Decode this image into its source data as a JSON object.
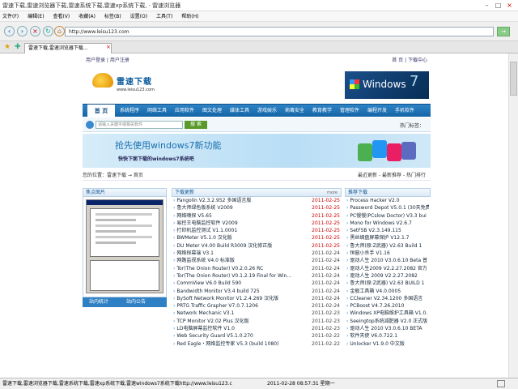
{
  "window": {
    "title": "雷速下载,雷速浏览器下载,雷速系统下载,雷速xp系统下载, · 雷速浏览器"
  },
  "menu": [
    "文件(F)",
    "编辑(E)",
    "查看(V)",
    "收藏(A)",
    "标签(B)",
    "设置(O)",
    "工具(T)",
    "帮助(H)"
  ],
  "address": {
    "url": "http://www.leisu123.com"
  },
  "tab": {
    "label": "雷速下载,雷速浏览器下载..."
  },
  "status": {
    "text": "雷速下载,雷速浏览器下载,雷速系统下载,雷速xp系统下载,雷速windows7系统下载http://www.leisu123.c",
    "datetime": "2011-02-28 08:57:31 星期一"
  },
  "page": {
    "top_left": "用户登录 | 用户注册",
    "top_right": "首 页 | 下载中心",
    "logo": {
      "name": "雷速下载",
      "url": "www.leisu123.com"
    },
    "win7": {
      "word": "Windows",
      "num": "7"
    },
    "nav": [
      "首 页",
      "系统程序",
      "网络工具",
      "应用软件",
      "图文处理",
      "媒体工具",
      "游戏娱乐",
      "病毒安全",
      "教育教学",
      "管理软件",
      "编程开发",
      "手机软件"
    ],
    "search": {
      "placeholder": "请输入关键字或相关软件",
      "button": "搜 索",
      "hot": "热门标签："
    },
    "banner": {
      "line1": "抢先使用windows7新功能",
      "line2": "快快下面下载的windows7系统吧"
    },
    "crumb": "您的位置：雷速下载 → 首页",
    "crumb_right": "最近更新 - 最新推荐 - 热门排行",
    "col1": {
      "title": "焦点图片",
      "tabs": [
        "站内统计",
        "站内公告"
      ]
    },
    "col2": {
      "title": "下载更新",
      "more": "more",
      "items": [
        {
          "name": "Pangolin V2.3.2.952 多国语言版",
          "date": "2011-02-25",
          "red": true
        },
        {
          "name": "鲁大师绿色版系统 V2009",
          "date": "2011-02-25",
          "red": true
        },
        {
          "name": "网络嗅探 V5.65",
          "date": "2011-02-25",
          "red": true
        },
        {
          "name": "易控王电脑监控软件 V2009",
          "date": "2011-02-25",
          "red": true
        },
        {
          "name": "打印机监控测试 V1.1.0001",
          "date": "2011-02-25",
          "red": true
        },
        {
          "name": "BWMeter V5.1.0 汉化版",
          "date": "2011-02-25",
          "red": true
        },
        {
          "name": "DU Meter V4.00 Build R3009 汉化修正版",
          "date": "2011-02-25",
          "red": true
        },
        {
          "name": "网络探幕端 V3.1",
          "date": "2011-02-24",
          "red": false
        },
        {
          "name": "网路监视系统 V4.0 标准版",
          "date": "2011-02-24",
          "red": false
        },
        {
          "name": "Tor(The Onion Router) V0.2.0.26 RC",
          "date": "2011-02-24",
          "red": false
        },
        {
          "name": "Tor(The Onion Router) V0.1.2.19 Final for Win...",
          "date": "2011-02-24",
          "red": false
        },
        {
          "name": "CommView V6.0 Build 590",
          "date": "2011-02-24",
          "red": false
        },
        {
          "name": "Bandwidth Monitor V3.4 build 725",
          "date": "2011-02-24",
          "red": false
        },
        {
          "name": "BySoft Network Monitor V1.2.4.269 汉化版",
          "date": "2011-02-24",
          "red": false
        },
        {
          "name": "PRTG Traffic Grapher V7.0.7.1206",
          "date": "2011-02-24",
          "red": false
        },
        {
          "name": "Network Mechanic V3.1",
          "date": "2011-02-23",
          "red": false
        },
        {
          "name": "TCP Monitor V2.02 Plus 汉化版",
          "date": "2011-02-23",
          "red": false
        },
        {
          "name": "LD电脑屏幕监控软件 V1.0",
          "date": "2011-02-23",
          "red": false
        },
        {
          "name": "Web Security Guard V5.1.0.270",
          "date": "2011-02-22",
          "red": false
        },
        {
          "name": "Red Eagle・网络监控专家 V5.3 (build 1080)",
          "date": "2011-02-22",
          "red": false
        }
      ]
    },
    "col3": {
      "title": "推荐下载",
      "items": [
        "Process Hacker V2.0",
        "Password Depot V5.0.1 (30天免费",
        "PC慢慢(PCslow Doctor) V3.3 bui",
        "Mono for Windows V2.6.7",
        "SetFSB V2.3.149.115",
        "黑丝绸盘屏幕保护 V12.1.7",
        "鲁大师(原:Z武器) V2.63 Build 1",
        "恒窗小杀手 V1.16",
        "驱动人生 2010 V3.0.6.10 Beta 普",
        "驱动人生2009 V2.2.27.2082 官方",
        "驱动人生 2009 V2.2.27.2082",
        "鲁大师(原:Z武器) V2.63 BUILD 1",
        "金舰工具箱 V4.0.0005",
        "CCleaner V2.34.1200 多国语言",
        "PCBoost V4.7.26.2010",
        "Windows XP电脑维护工具箱 V1.0.",
        "Seeingtop系统减肥器 V2.0 正式版",
        "驱动人生 2010 V3.0.6.10 BETA",
        "软件天使 V6.0.722.1",
        "Unlocker V1.9.0 中文版"
      ]
    }
  }
}
